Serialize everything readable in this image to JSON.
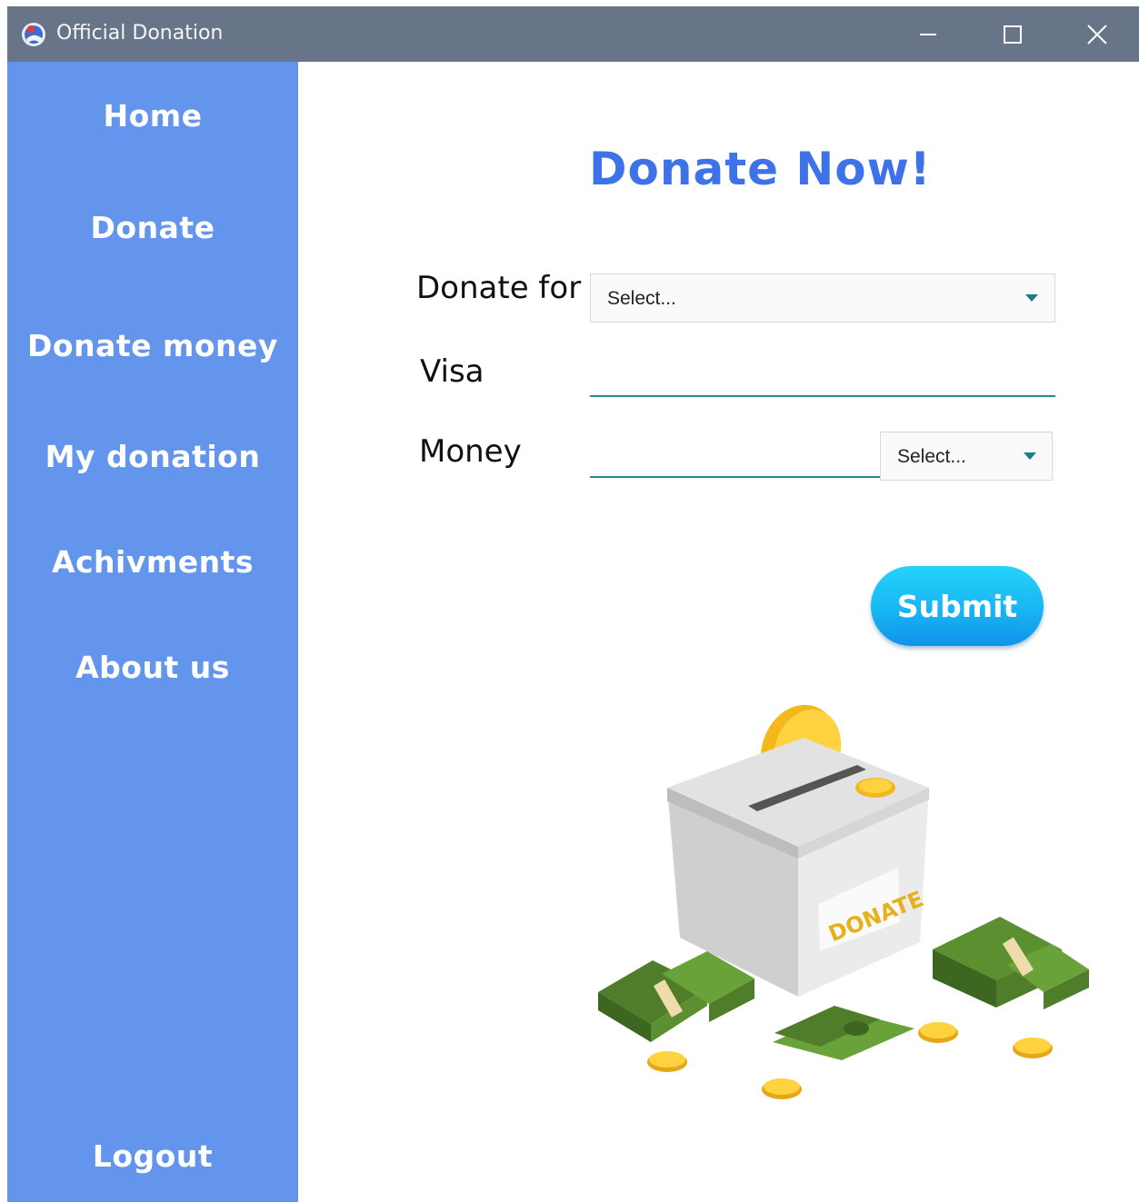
{
  "window": {
    "title": "Official Donation"
  },
  "sidebar": {
    "items": [
      {
        "label": "Home"
      },
      {
        "label": "Donate"
      },
      {
        "label": "Donate money"
      },
      {
        "label": "My donation"
      },
      {
        "label": "Achivments"
      },
      {
        "label": "About us"
      }
    ],
    "logout_label": "Logout",
    "color": "#6495ed"
  },
  "main": {
    "heading": "Donate Now!",
    "form": {
      "donate_for_label": "Donate for",
      "donate_for_select": "Select...",
      "visa_label": "Visa",
      "visa_value": "",
      "money_label": "Money",
      "money_value": "",
      "currency_select": "Select..."
    },
    "submit_label": "Submit",
    "illustration": {
      "box_label": "DONATE"
    }
  },
  "colors": {
    "titlebar": "#687487",
    "heading": "#3e72e8",
    "accent": "#2a8a94",
    "submit": "#18b5f3"
  }
}
